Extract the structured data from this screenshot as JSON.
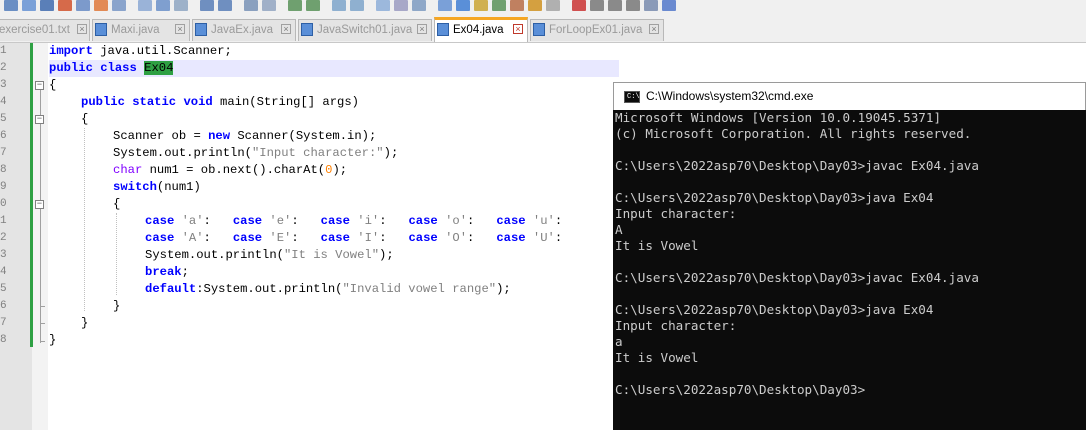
{
  "colors": {
    "keyword": "#0000ff",
    "type_keyword": "#8000ff",
    "string": "#808080",
    "number": "#ff8000",
    "highlight": "#2ea043",
    "active_tab_accent": "#f5a623",
    "terminal_bg": "#0c0c0c",
    "terminal_fg": "#cccccc"
  },
  "tabs": [
    {
      "label": "exercise01.txt",
      "active": false
    },
    {
      "label": "Maxi.java",
      "active": false
    },
    {
      "label": "JavaEx.java",
      "active": false
    },
    {
      "label": "JavaSwitch01.java",
      "active": false
    },
    {
      "label": "Ex04.java",
      "active": true
    },
    {
      "label": "ForLoopEx01.java",
      "active": false
    }
  ],
  "tab_close_glyph": "×",
  "line_numbers": [
    "1",
    "2",
    "3",
    "4",
    "5",
    "6",
    "7",
    "8",
    "9",
    "0",
    "1",
    "2",
    "3",
    "4",
    "5",
    "6",
    "7",
    "8"
  ],
  "code": {
    "l1_kw": "import",
    "l1_rest": " java.util.Scanner;",
    "l2_kw1": "public",
    "l2_kw2": "class",
    "l2_name": "Ex04",
    "l3": "{",
    "l4_kw1": "public",
    "l4_kw2": "static",
    "l4_kw3": "void",
    "l4_rest": " main(String[] args)",
    "l5": "{",
    "l6_a": "Scanner ob = ",
    "l6_kw": "new",
    "l6_b": " Scanner(System.in);",
    "l7_a": "System.out.println(",
    "l7_str": "\"Input character:\"",
    "l7_b": ");",
    "l8_kw": "char",
    "l8_a": " num1 = ob.next().charAt(",
    "l8_num": "0",
    "l8_b": ");",
    "l9_kw": "switch",
    "l9_rest": "(num1)",
    "l10": "{",
    "l11_case": "case",
    "l11_v1": "'a'",
    "l11_v2": "'e'",
    "l11_v3": "'i'",
    "l11_v4": "'o'",
    "l11_v5": "'u'",
    "l12_case": "case",
    "l12_v1": "'A'",
    "l12_v2": "'E'",
    "l12_v3": "'I'",
    "l12_v4": "'O'",
    "l12_v5": "'U'",
    "colon": ":",
    "l13_a": "System.out.println(",
    "l13_str": "\"It is Vowel\"",
    "l13_b": ");",
    "l14_kw": "break",
    "l14_b": ";",
    "l15_kw": "default",
    "l15_a": ":System.out.println(",
    "l15_str": "\"Invalid vowel range\"",
    "l15_b": ");",
    "l16": "}",
    "l17": "}",
    "l18": "}"
  },
  "cmd": {
    "title": "C:\\Windows\\system32\\cmd.exe",
    "icon_text": "C:\\",
    "lines": [
      "Microsoft Windows [Version 10.0.19045.5371]",
      "(c) Microsoft Corporation. All rights reserved.",
      "",
      "C:\\Users\\2022asp70\\Desktop\\Day03>javac Ex04.java",
      "",
      "C:\\Users\\2022asp70\\Desktop\\Day03>java Ex04",
      "Input character:",
      "A",
      "It is Vowel",
      "",
      "C:\\Users\\2022asp70\\Desktop\\Day03>javac Ex04.java",
      "",
      "C:\\Users\\2022asp70\\Desktop\\Day03>java Ex04",
      "Input character:",
      "a",
      "It is Vowel",
      "",
      "C:\\Users\\2022asp70\\Desktop\\Day03>"
    ]
  }
}
